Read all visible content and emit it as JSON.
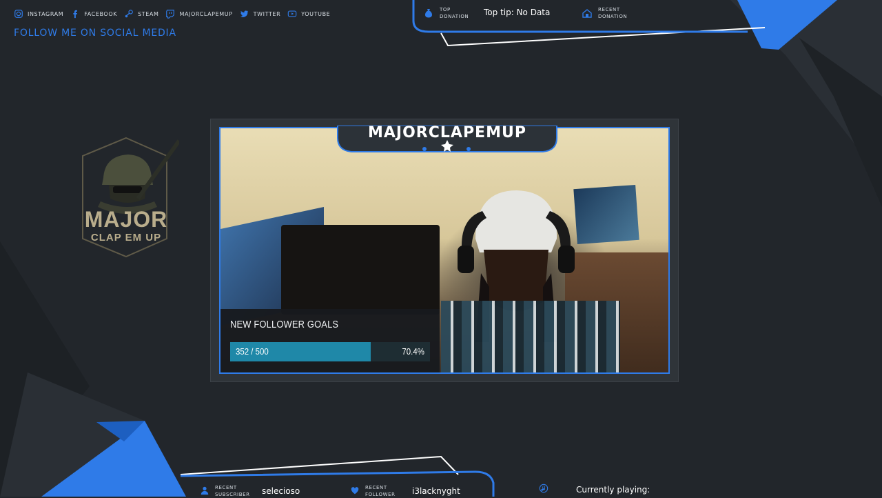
{
  "social": [
    {
      "icon": "instagram-icon",
      "label": "instagram"
    },
    {
      "icon": "facebook-icon",
      "label": "facebook"
    },
    {
      "icon": "steam-icon",
      "label": "steam"
    },
    {
      "icon": "twitch-icon",
      "label": "majorclapemup"
    },
    {
      "icon": "twitter-icon",
      "label": "twitter"
    },
    {
      "icon": "youtube-icon",
      "label": "youtube"
    }
  ],
  "follow_text": "FOLLOW ME ON SOCIAL MEDIA",
  "top_panel": {
    "top_donation_label": "TOP DONATION",
    "top_tip_text": "Top tip: No Data",
    "recent_donation_label": "RECENT DONATION"
  },
  "logo": {
    "line1": "MAJOR",
    "line2": "CLAP EM UP"
  },
  "camera": {
    "name": "MAJORCLAPEMUP"
  },
  "goal": {
    "title": "NEW FOLLOWER GOALS",
    "count_text": "352 / 500",
    "percent_text": "70.4%",
    "progress": 0.704
  },
  "bottom": {
    "recent_subscriber_label": "RECENT SUBSCRIBER",
    "recent_subscriber_value": "selecioso",
    "recent_follower_label": "RECENT FOLLOWER",
    "recent_follower_value": "i3lacknyght",
    "currently_playing_label": "Currently playing:"
  },
  "colors": {
    "accent": "#2f7be8",
    "background": "#22262b",
    "goal_fill": "#1f88a8"
  }
}
